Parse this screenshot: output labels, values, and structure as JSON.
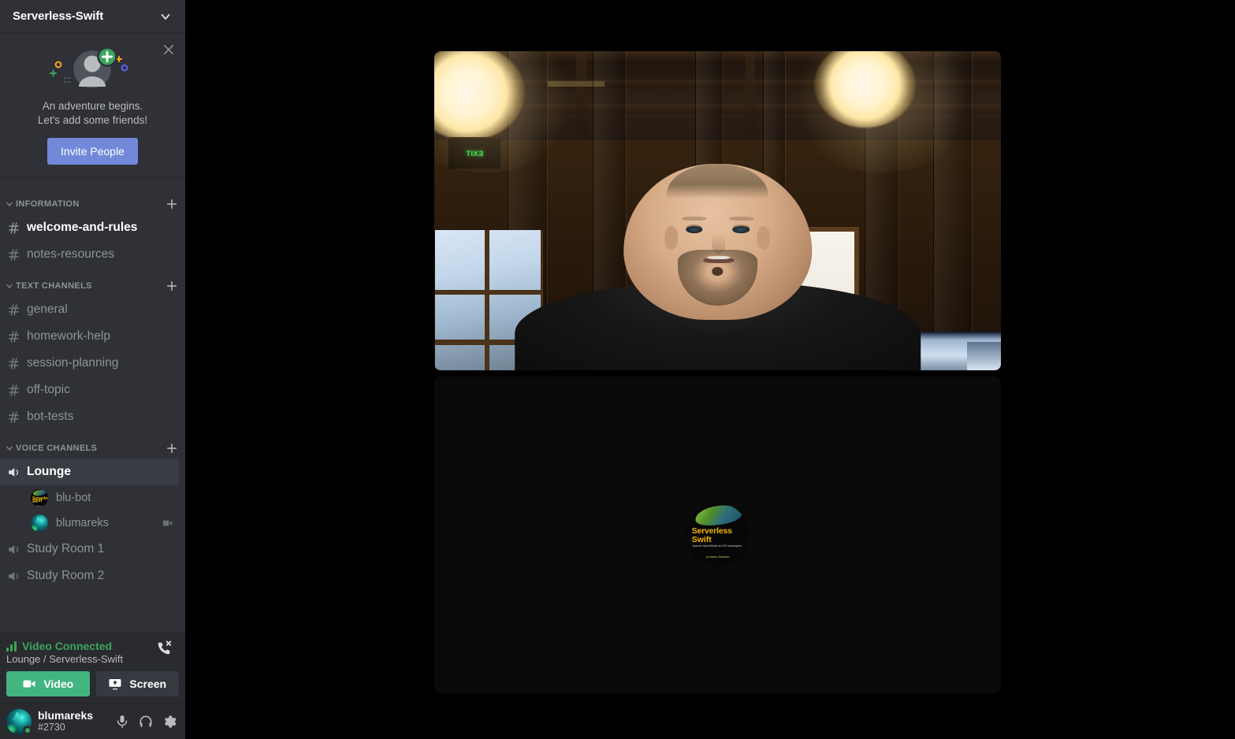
{
  "server": {
    "name": "Serverless-Swift",
    "dropdown_icon": "chevron-down-icon"
  },
  "invite_banner": {
    "close_icon": "close-icon",
    "art_icon": "add-friend-illustration",
    "line1": "An adventure begins.",
    "line2": "Let's add some friends!",
    "button_label": "Invite People",
    "button_color": "#7289da"
  },
  "categories": [
    {
      "name": "INFORMATION",
      "add_icon": "plus-icon",
      "collapse_icon": "chevron-down-icon",
      "channels": [
        {
          "name": "welcome-and-rules",
          "icon": "hash-icon",
          "unread": true
        },
        {
          "name": "notes-resources",
          "icon": "hash-icon",
          "unread": false
        }
      ]
    },
    {
      "name": "TEXT CHANNELS",
      "add_icon": "plus-icon",
      "collapse_icon": "chevron-down-icon",
      "channels": [
        {
          "name": "general",
          "icon": "hash-icon",
          "unread": false
        },
        {
          "name": "homework-help",
          "icon": "hash-icon",
          "unread": false
        },
        {
          "name": "session-planning",
          "icon": "hash-icon",
          "unread": false
        },
        {
          "name": "off-topic",
          "icon": "hash-icon",
          "unread": false
        },
        {
          "name": "bot-tests",
          "icon": "hash-icon",
          "unread": false
        }
      ]
    },
    {
      "name": "VOICE CHANNELS",
      "add_icon": "plus-icon",
      "collapse_icon": "chevron-down-icon",
      "channels": [
        {
          "name": "Lounge",
          "icon": "speaker-icon",
          "active": true
        },
        {
          "name": "Study Room 1",
          "icon": "speaker-icon",
          "active": false
        },
        {
          "name": "Study Room 2",
          "icon": "speaker-icon",
          "active": false
        }
      ]
    }
  ],
  "voice_members": [
    {
      "name": "blu-bot",
      "avatar": "serverless-swift-book-avatar",
      "camera_on": false
    },
    {
      "name": "blumareks",
      "avatar": "teal-fractal-avatar",
      "camera_on": true,
      "camera_icon": "video-camera-icon"
    }
  ],
  "voice_panel": {
    "signal_icon": "signal-bars-icon",
    "status": "Video Connected",
    "status_color": "#3ba55d",
    "location": "Lounge / Serverless-Swift",
    "disconnect_icon": "phone-hangup-icon",
    "video_button": {
      "label": "Video",
      "icon": "video-camera-icon",
      "color": "#43b581",
      "active": true
    },
    "screen_button": {
      "label": "Screen",
      "icon": "screen-share-icon",
      "color": "#36393f",
      "active": false
    }
  },
  "user_panel": {
    "name": "blumareks",
    "tag": "#2730",
    "avatar": "teal-fractal-avatar",
    "presence": "online",
    "presence_color": "#3ba55d",
    "mic_icon": "microphone-icon",
    "headset_icon": "headphones-icon",
    "settings_icon": "gear-icon"
  },
  "video_stage": {
    "background_color": "#000000",
    "tiles": [
      {
        "type": "camera-feed",
        "description": "Webcam video of a man with short hair and a goatee wearing a black shirt, in a room with exposed wood-beam ceiling, two bright pendant lights, a green EXIT sign, windows on the left, a bright doorway on the right and laptops on the desk"
      },
      {
        "type": "avatar-placeholder",
        "avatar": "serverless-swift-book-avatar",
        "avatar_text": {
          "title_line1": "Serverless",
          "title_line2": "Swift",
          "subtitle": "Apache OpenWhisk for iOS developers",
          "footer": "by Marek Sadowski"
        }
      }
    ]
  }
}
